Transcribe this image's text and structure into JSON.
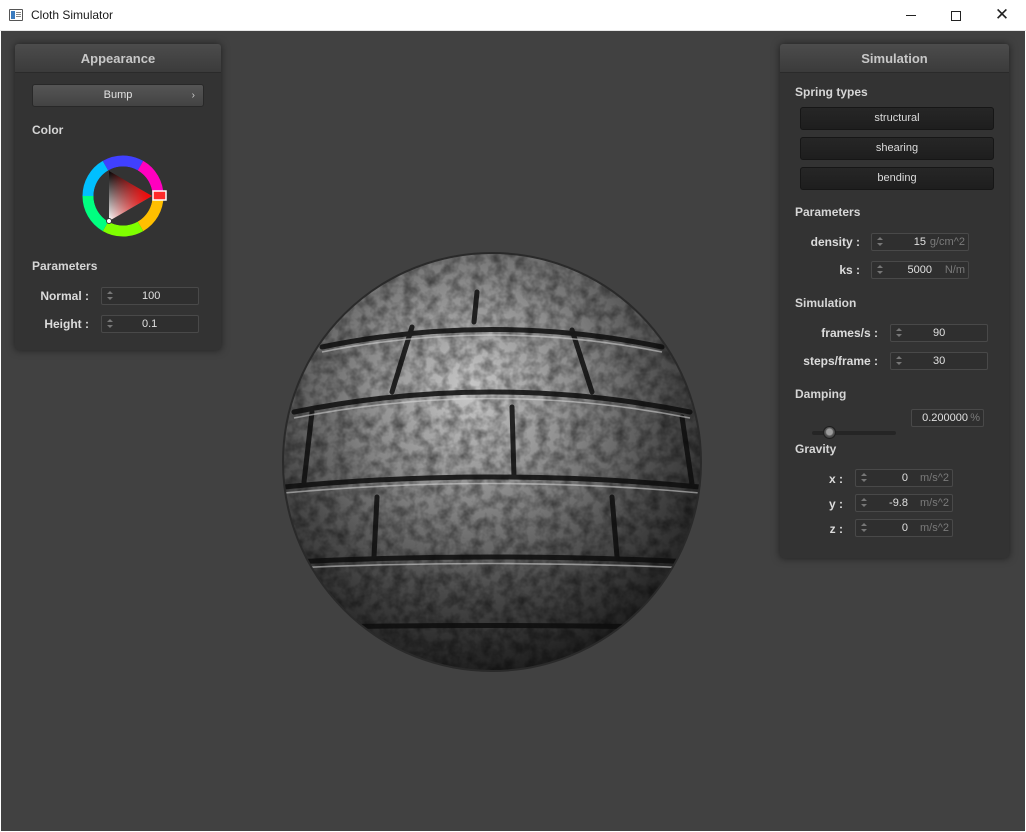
{
  "window": {
    "title": "Cloth Simulator",
    "controls": {
      "minimize": "minimize-icon",
      "maximize": "maximize-icon",
      "close": "close-icon"
    }
  },
  "appearance": {
    "title": "Appearance",
    "shader_dropdown": {
      "selected": "Bump",
      "icon": "chevron-right-icon"
    },
    "color_label": "Color",
    "color_wheel": {
      "hue_selected": "red",
      "selected_color": "#ff0000"
    },
    "parameters_label": "Parameters",
    "normal": {
      "label": "Normal :",
      "value": "100"
    },
    "height": {
      "label": "Height :",
      "value": "0.1"
    }
  },
  "simulation": {
    "title": "Simulation",
    "spring_types_label": "Spring types",
    "spring_buttons": [
      "structural",
      "shearing",
      "bending"
    ],
    "parameters_label": "Parameters",
    "density": {
      "label": "density :",
      "value": "15",
      "unit": "g/cm^2"
    },
    "ks": {
      "label": "ks :",
      "value": "5000",
      "unit": "N/m"
    },
    "simulation_label": "Simulation",
    "frames": {
      "label": "frames/s :",
      "value": "90"
    },
    "steps": {
      "label": "steps/frame :",
      "value": "30"
    },
    "damping_label": "Damping",
    "damping": {
      "value": "0.200000",
      "unit": "%",
      "slider_fraction": 0.2
    },
    "gravity_label": "Gravity",
    "gravity_x": {
      "label": "x :",
      "value": "0",
      "unit": "m/s^2"
    },
    "gravity_y": {
      "label": "y :",
      "value": "-9.8",
      "unit": "m/s^2"
    },
    "gravity_z": {
      "label": "z :",
      "value": "0",
      "unit": "m/s^2"
    }
  },
  "colors": {
    "viewport_bg": "#414141",
    "panel_bg": "#333333",
    "accent": "#ff0000"
  }
}
